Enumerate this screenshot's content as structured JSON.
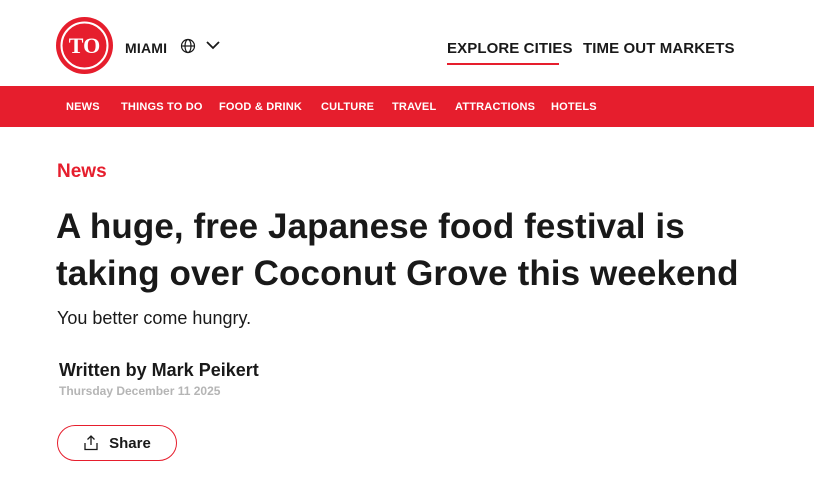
{
  "header": {
    "logo_text": "TO",
    "city": "MIAMI",
    "nav": [
      {
        "label": "EXPLORE CITIES"
      },
      {
        "label": "TIME OUT MARKETS"
      }
    ]
  },
  "menu": {
    "items": [
      {
        "label": "NEWS"
      },
      {
        "label": "THINGS TO DO"
      },
      {
        "label": "FOOD & DRINK"
      },
      {
        "label": "CULTURE"
      },
      {
        "label": "TRAVEL"
      },
      {
        "label": "ATTRACTIONS"
      },
      {
        "label": "HOTELS"
      }
    ]
  },
  "article": {
    "category": "News",
    "title": "A huge, free Japanese food festival is taking over Coconut Grove this weekend",
    "subtitle": "You better come hungry.",
    "byline": "Written by Mark Peikert",
    "date": "Thursday December 11 2025",
    "share_label": "Share"
  },
  "colors": {
    "brand_red": "#e61e2d",
    "text": "#191919",
    "muted": "#b5b5b5"
  },
  "icons": {
    "globe": "globe-icon",
    "chevron": "chevron-down-icon",
    "share": "share-icon"
  }
}
